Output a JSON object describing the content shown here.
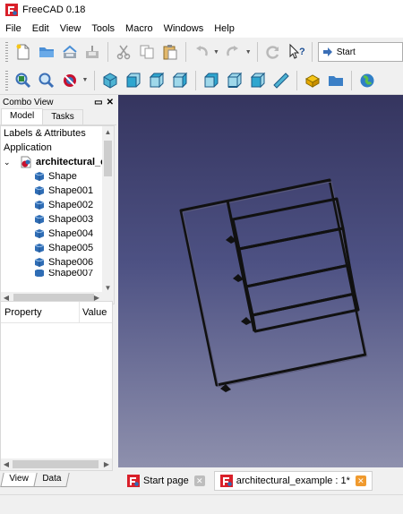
{
  "window": {
    "title": "FreeCAD 0.18",
    "icon": "freecad-logo-icon"
  },
  "menubar": {
    "items": [
      {
        "label": "File"
      },
      {
        "label": "Edit"
      },
      {
        "label": "View"
      },
      {
        "label": "Tools"
      },
      {
        "label": "Macro"
      },
      {
        "label": "Windows"
      },
      {
        "label": "Help"
      }
    ]
  },
  "toolbar": {
    "workbench_value": "Start",
    "icons_row1": [
      "new-document-icon",
      "open-folder-icon",
      "save-icon",
      "save-as-icon",
      "cut-icon",
      "copy-icon",
      "paste-icon",
      "undo-icon",
      "redo-icon",
      "refresh-icon",
      "whats-this-icon",
      "workbench-selector-icon"
    ],
    "icons_row2": [
      "fit-all-icon",
      "fit-selection-icon",
      "draw-style-icon",
      "isometric-view-icon",
      "front-view-icon",
      "top-view-icon",
      "right-view-icon",
      "rear-view-icon",
      "bottom-view-icon",
      "left-view-icon",
      "measure-icon",
      "part-icon",
      "group-icon",
      "web-icon"
    ]
  },
  "combo_view": {
    "title": "Combo View",
    "tabs": [
      {
        "label": "Model"
      },
      {
        "label": "Tasks"
      }
    ],
    "labels_header": "Labels & Attributes",
    "application_label": "Application",
    "document_label": "architectural_e",
    "shapes": [
      {
        "label": "Shape"
      },
      {
        "label": "Shape001"
      },
      {
        "label": "Shape002"
      },
      {
        "label": "Shape003"
      },
      {
        "label": "Shape004"
      },
      {
        "label": "Shape005"
      },
      {
        "label": "Shape006"
      },
      {
        "label": "Shape007"
      }
    ],
    "property_header": "Property",
    "value_header": "Value",
    "bottom_tabs": [
      {
        "label": "View"
      },
      {
        "label": "Data"
      }
    ]
  },
  "document_tabs": [
    {
      "label": "Start page",
      "active": false
    },
    {
      "label": "architectural_example : 1*",
      "active": true
    }
  ],
  "colors": {
    "viewport_top": "#35355f",
    "viewport_bottom": "#8e90ad",
    "accent_orange": "#f09a2e",
    "shape_blue": "#2f6db5"
  }
}
